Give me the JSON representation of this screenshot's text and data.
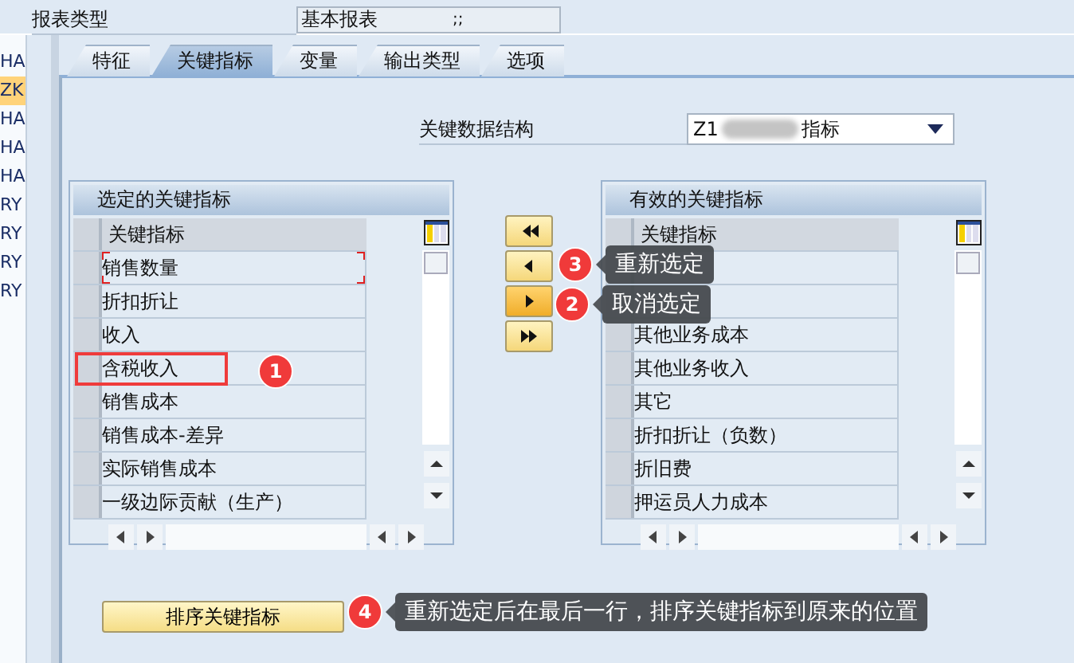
{
  "report_type": {
    "label": "报表类型",
    "value": "基本报表",
    "suffix": ";;"
  },
  "side_list": [
    {
      "text": "HA",
      "selected": false
    },
    {
      "text": "ZK",
      "selected": true
    },
    {
      "text": "HA",
      "selected": false
    },
    {
      "text": "HA",
      "selected": false
    },
    {
      "text": "HA",
      "selected": false
    },
    {
      "text": "RY",
      "selected": false
    },
    {
      "text": "RY",
      "selected": false
    },
    {
      "text": "RY",
      "selected": false
    },
    {
      "text": "RY",
      "selected": false
    }
  ],
  "tabs": [
    {
      "label": "特征",
      "selected": false
    },
    {
      "label": "关键指标",
      "selected": true
    },
    {
      "label": "变量",
      "selected": false
    },
    {
      "label": "输出类型",
      "selected": false
    },
    {
      "label": "选项",
      "selected": false
    }
  ],
  "key_structure": {
    "label": "关键数据结构",
    "prefix": "Z1",
    "suffix": "指标"
  },
  "selected_table": {
    "title": "选定的关键指标",
    "column": "关键指标",
    "rows": [
      {
        "kind": "text",
        "label": "销售数量",
        "focused": true,
        "highlighted": false
      },
      {
        "kind": "text",
        "label": "折扣折让",
        "focused": false,
        "highlighted": false
      },
      {
        "kind": "text",
        "label": "收入",
        "focused": false,
        "highlighted": false
      },
      {
        "kind": "text",
        "label": "含税收入",
        "focused": false,
        "highlighted": true
      },
      {
        "kind": "text",
        "label": "销售成本",
        "focused": false,
        "highlighted": false
      },
      {
        "kind": "text",
        "label": "销售成本-差异",
        "focused": false,
        "highlighted": false
      },
      {
        "kind": "text",
        "label": "实际销售成本",
        "focused": false,
        "highlighted": false
      },
      {
        "kind": "text",
        "label": "一级边际贡献（生产）",
        "focused": false,
        "highlighted": false
      }
    ]
  },
  "move_buttons": [
    {
      "kind": "first",
      "pressed": false
    },
    {
      "kind": "prev",
      "pressed": false
    },
    {
      "kind": "next",
      "pressed": true
    },
    {
      "kind": "last",
      "pressed": false
    }
  ],
  "available_table": {
    "title": "有效的关键指标",
    "column": "关键指标",
    "rows": [
      {
        "kind": "covered"
      },
      {
        "kind": "covered"
      },
      {
        "kind": "text",
        "label": "其他业务成本"
      },
      {
        "kind": "text",
        "label": "其他业务收入"
      },
      {
        "kind": "text",
        "label": "其它"
      },
      {
        "kind": "text",
        "label": "折扣折让（负数）"
      },
      {
        "kind": "text",
        "label": "折旧费"
      },
      {
        "kind": "text",
        "label": "押运员人力成本"
      }
    ]
  },
  "sort_button": {
    "label": "排序关键指标"
  },
  "annotations": [
    {
      "number": "1"
    },
    {
      "number": "3",
      "text": "重新选定"
    },
    {
      "number": "2",
      "text": "取消选定"
    },
    {
      "number": "4",
      "text": "重新选定后在最后一行，排序关键指标到原来的位置"
    }
  ]
}
